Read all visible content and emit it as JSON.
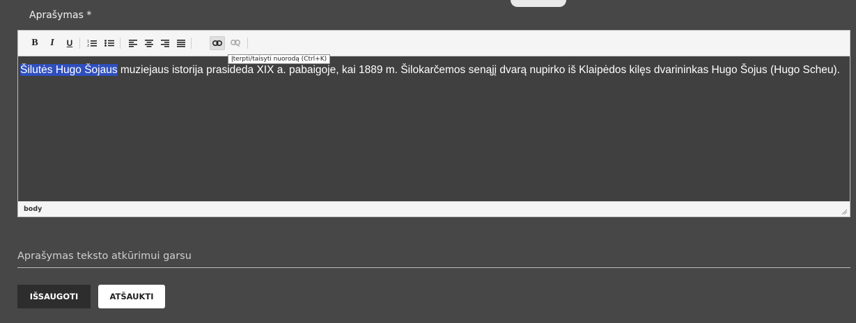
{
  "description_field": {
    "label": "Aprašymas *"
  },
  "toolbar": {
    "buttons": [
      {
        "name": "bold",
        "glyph": "B"
      },
      {
        "name": "italic",
        "glyph": "I"
      },
      {
        "name": "underline",
        "glyph": "U"
      },
      {
        "name": "numbered-list",
        "icon": "numbered-list-icon"
      },
      {
        "name": "bulleted-list",
        "icon": "bulleted-list-icon"
      },
      {
        "name": "align-left",
        "icon": "align-left-icon"
      },
      {
        "name": "align-center",
        "icon": "align-center-icon"
      },
      {
        "name": "align-right",
        "icon": "align-right-icon"
      },
      {
        "name": "align-justify",
        "icon": "align-justify-icon"
      },
      {
        "name": "insert-link",
        "icon": "link-icon",
        "state": "hover"
      },
      {
        "name": "unlink",
        "icon": "unlink-icon",
        "state": "disabled"
      }
    ],
    "tooltip": "Įterpti/taisyti nuorodą (Ctrl+K)"
  },
  "editor": {
    "selected_text": "Šilutės Hugo Šojaus",
    "body_text": " muziejaus istorija prasideda XIX a. pabaigoje, kai 1889 m. Šilokarčemos senąjį dvarą nupirko iš Klaipėdos kilęs dvarininkas Hugo Šojus (Hugo Scheu).",
    "status_path": "body"
  },
  "audio_field": {
    "label": "Aprašymas teksto atkūrimui garsu"
  },
  "actions": {
    "save_label": "IŠSAUGOTI",
    "cancel_label": "ATŠAUKTI"
  },
  "colors": {
    "background": "#474747",
    "editor_background": "#404040",
    "selection": "#2f4fbd",
    "save_button": "#2d2d2d",
    "cancel_button": "#ffffff"
  }
}
